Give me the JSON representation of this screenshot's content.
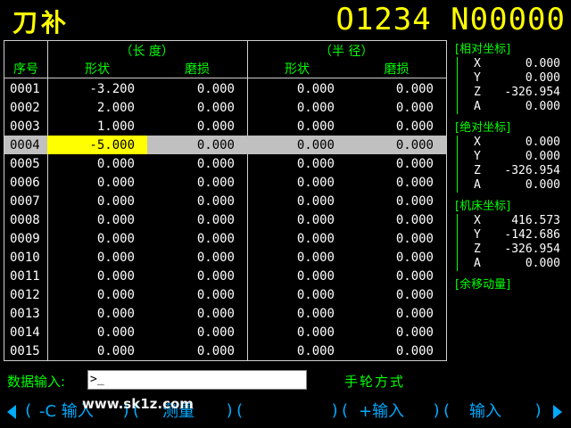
{
  "header": {
    "title": "刀补",
    "program": "O1234 N00000"
  },
  "table": {
    "group_length": "（长    度）",
    "group_radius": "（半    径）",
    "col_index": "序号",
    "col_shape": "形状",
    "col_wear": "磨损",
    "col_shape_r": "形状",
    "col_wear_r": "磨损",
    "rows": [
      [
        "0001",
        "-3.200",
        "0.000",
        "0.000",
        "0.000"
      ],
      [
        "0002",
        "2.000",
        "0.000",
        "0.000",
        "0.000"
      ],
      [
        "0003",
        "1.000",
        "0.000",
        "0.000",
        "0.000"
      ],
      [
        "0004",
        "-5.000",
        "0.000",
        "0.000",
        "0.000"
      ],
      [
        "0005",
        "0.000",
        "0.000",
        "0.000",
        "0.000"
      ],
      [
        "0006",
        "0.000",
        "0.000",
        "0.000",
        "0.000"
      ],
      [
        "0007",
        "0.000",
        "0.000",
        "0.000",
        "0.000"
      ],
      [
        "0008",
        "0.000",
        "0.000",
        "0.000",
        "0.000"
      ],
      [
        "0009",
        "0.000",
        "0.000",
        "0.000",
        "0.000"
      ],
      [
        "0010",
        "0.000",
        "0.000",
        "0.000",
        "0.000"
      ],
      [
        "0011",
        "0.000",
        "0.000",
        "0.000",
        "0.000"
      ],
      [
        "0012",
        "0.000",
        "0.000",
        "0.000",
        "0.000"
      ],
      [
        "0013",
        "0.000",
        "0.000",
        "0.000",
        "0.000"
      ],
      [
        "0014",
        "0.000",
        "0.000",
        "0.000",
        "0.000"
      ],
      [
        "0015",
        "0.000",
        "0.000",
        "0.000",
        "0.000"
      ]
    ],
    "selected_row": "0004"
  },
  "coords": {
    "relative": {
      "title": "[相对坐标]",
      "X": "0.000",
      "Y": "0.000",
      "Z": "-326.954",
      "A": "0.000"
    },
    "absolute": {
      "title": "[绝对坐标]",
      "X": "0.000",
      "Y": "0.000",
      "Z": "-326.954",
      "A": "0.000"
    },
    "machine": {
      "title": "[机床坐标]",
      "X": "416.573",
      "Y": "-142.686",
      "Z": "-326.954",
      "A": "0.000"
    },
    "remaining": {
      "title": "[余移动量]"
    }
  },
  "input": {
    "label": "数据输入:",
    "value": ">_"
  },
  "mode": "手轮方式",
  "softkeys": {
    "k1": "-C 输入",
    "k2": "测量",
    "k4": "+输入",
    "k5": "输入"
  },
  "watermark": "www.sk1z.com",
  "colors": {
    "title": "#ffff00",
    "label": "#00ff00",
    "softkey": "#00aaff",
    "selected_cell": "#ffff00",
    "selected_row": "#c0c0c0"
  }
}
